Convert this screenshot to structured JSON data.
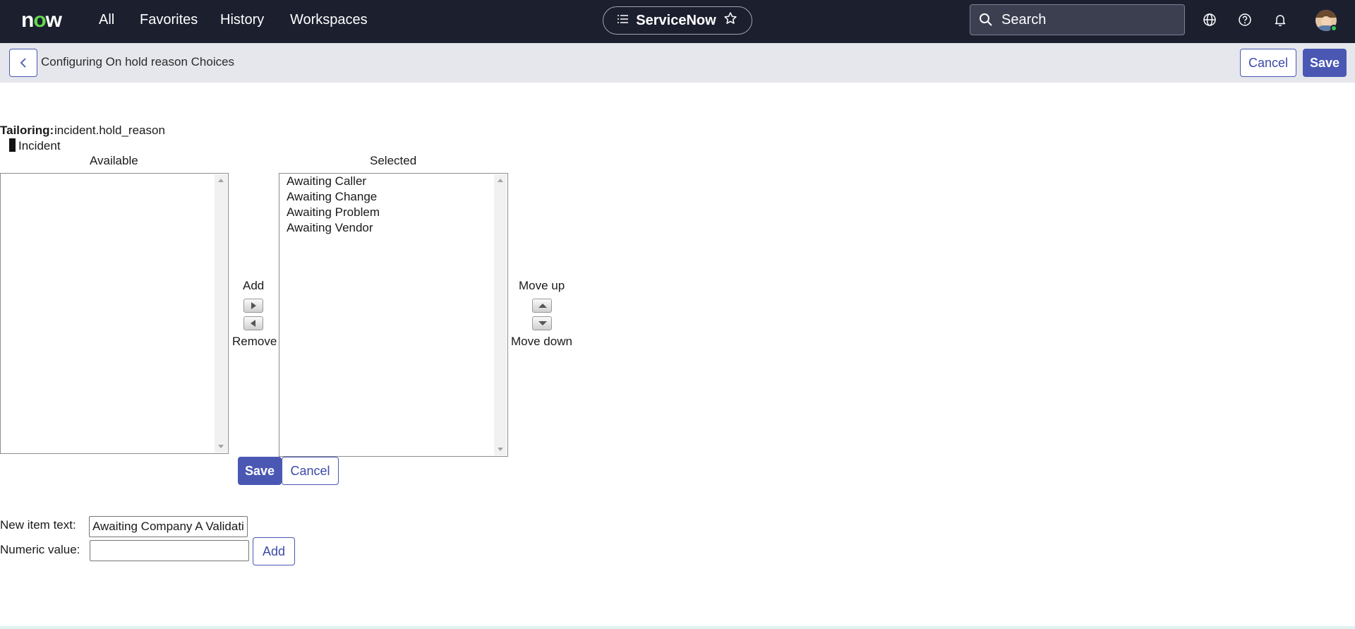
{
  "topnav": {
    "logo": "now",
    "links": [
      "All",
      "Favorites",
      "History",
      "Workspaces"
    ],
    "app_pill": "ServiceNow",
    "search_placeholder": "Search"
  },
  "header": {
    "title": "Configuring On hold reason Choices",
    "cancel_label": "Cancel",
    "save_label": "Save"
  },
  "tailoring": {
    "label": "Tailoring:",
    "value": "incident.hold_reason",
    "table": "Incident"
  },
  "available": {
    "heading": "Available",
    "items": []
  },
  "selected": {
    "heading": "Selected",
    "items": [
      "Awaiting Caller",
      "Awaiting Change",
      "Awaiting Problem",
      "Awaiting Vendor"
    ]
  },
  "controls": {
    "add_label": "Add",
    "remove_label": "Remove",
    "move_up_label": "Move up",
    "move_down_label": "Move down"
  },
  "form_buttons": {
    "save_label": "Save",
    "cancel_label": "Cancel"
  },
  "new_item": {
    "text_label": "New item text:",
    "text_value": "Awaiting Company A Validation",
    "numeric_label": "Numeric value:",
    "numeric_value": "",
    "add_label": "Add"
  },
  "colors": {
    "nav_bg": "#1c1f2e",
    "header_bg": "#e5e7ec",
    "accent": "#4a58b4",
    "logo_accent": "#62d84e"
  }
}
